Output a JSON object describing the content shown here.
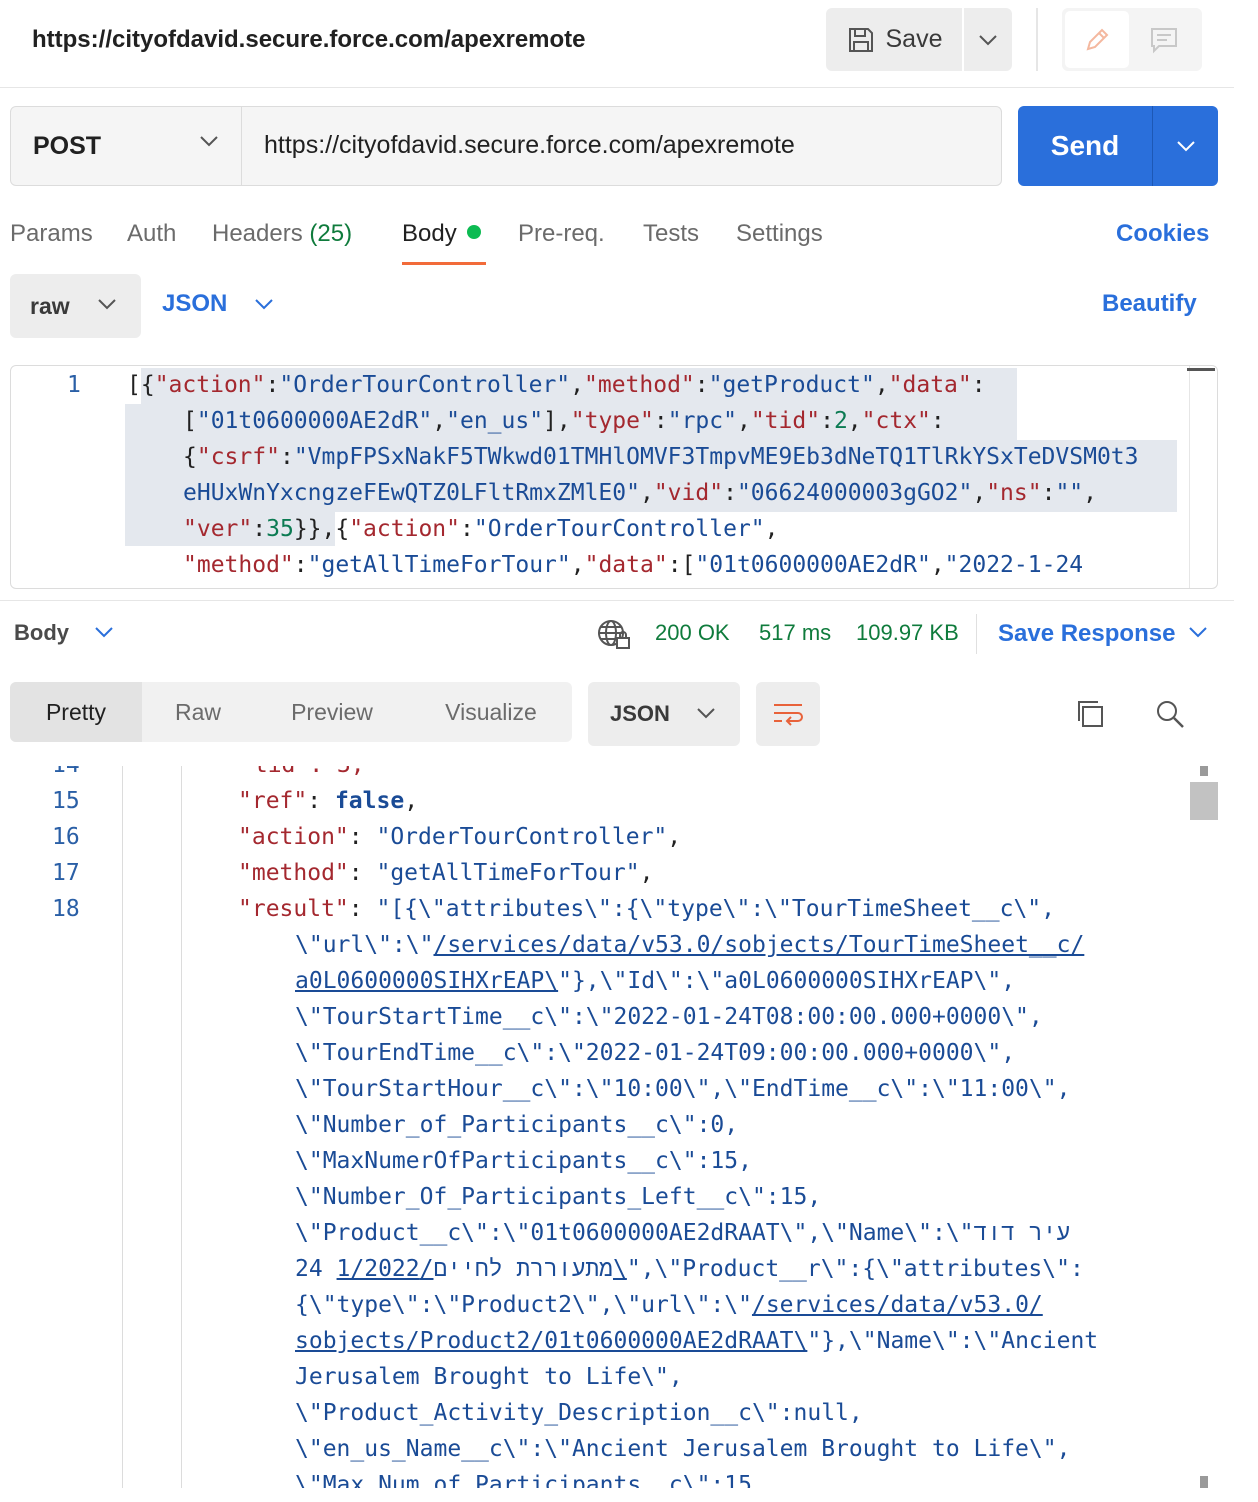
{
  "titlebar": {
    "title": "https://cityofdavid.secure.force.com/apexremote",
    "save_label": "Save"
  },
  "request": {
    "method": "POST",
    "url": "https://cityofdavid.secure.force.com/apexremote",
    "send_label": "Send"
  },
  "tabs": {
    "params": "Params",
    "auth": "Auth",
    "headers": "Headers",
    "headers_count": "(25)",
    "body": "Body",
    "prereq": "Pre-req.",
    "tests": "Tests",
    "settings": "Settings",
    "cookies": "Cookies"
  },
  "body_options": {
    "mode": "raw",
    "language": "JSON",
    "beautify": "Beautify"
  },
  "request_editor": {
    "line_number": "1",
    "lines": [
      "[{\"action\":\"OrderTourController\",\"method\":\"getProduct\",\"data\":",
      "[\"01t0600000AE2dR\",\"en_us\"],\"type\":\"rpc\",\"tid\":2,\"ctx\":",
      "{\"csrf\":\"VmpFPSxNakF5TWkwd01TMHlOMVF3TmpvME9Eb3dNeTQ1TlRkYSxTeDVSM0t3",
      "eHUxWnYxcngzeFEwQTZ0LFltRmxZMlE0\",\"vid\":\"06624000003gGO2\",\"ns\":\"\",",
      "\"ver\":35}},{\"action\":\"OrderTourController\",",
      "\"method\":\"getAllTimeForTour\",\"data\":[\"01t0600000AE2dR\",\"2022-1-24"
    ]
  },
  "response_header": {
    "body_label": "Body",
    "status": "200 OK",
    "time": "517 ms",
    "size": "109.97 KB",
    "save_response": "Save Response"
  },
  "response_view": {
    "tabs": [
      "Pretty",
      "Raw",
      "Preview",
      "Visualize"
    ],
    "active_tab": "Pretty",
    "format": "JSON"
  },
  "response_editor": {
    "partial_line_number": "14",
    "partial_line": "\"tid\": 3,",
    "line_numbers": [
      "15",
      "16",
      "17",
      "18"
    ],
    "line15": {
      "key": "\"ref\"",
      "value": "false"
    },
    "line16": {
      "key": "\"action\"",
      "value": "\"OrderTourController\""
    },
    "line17": {
      "key": "\"method\"",
      "value": "\"getAllTimeForTour\""
    },
    "line18": {
      "key": "\"result\"",
      "value": "\"[{\\\"attributes\\\":{\\\"type\\\":\\\"TourTimeSheet__c\\\","
    },
    "wrap1_pre": "\\\"url\\\":\\\"",
    "wrap1_link": "/services/data/v53.0/sobjects/TourTimeSheet__c/",
    "wrap2_link": "a0L0600000SIHXrEAP\\",
    "wrap2_rest": "\"},\\\"Id\\\":\\\"a0L0600000SIHXrEAP\\\",",
    "wrap3": "\\\"TourStartTime__c\\\":\\\"2022-01-24T08:00:00.000+0000\\\",",
    "wrap4": "\\\"TourEndTime__c\\\":\\\"2022-01-24T09:00:00.000+0000\\\",",
    "wrap5": "\\\"TourStartHour__c\\\":\\\"10:00\\\",\\\"EndTime__c\\\":\\\"11:00\\\",",
    "wrap6": "\\\"Number_of_Participants__c\\\":0,",
    "wrap7": "\\\"MaxNumerOfParticipants__c\\\":15,",
    "wrap8": "\\\"Number_Of_Participants_Left__c\\\":15,",
    "wrap9": "\\\"Product__c\\\":\\\"01t0600000AE2dRAAT\\\",\\\"Name\\\":\\\"עיר דוד",
    "wrap10_pre": "24 מתעוררת לחיים",
    "wrap10_link": "/1/2022\\",
    "wrap10_rest": "\",\\\"Product__r\\\":{\\\"attributes\\\":",
    "wrap11_pre": "{\\\"type\\\":\\\"Product2\\\",\\\"url\\\":\\\"",
    "wrap11_link": "/services/data/v53.0/",
    "wrap12_link": "sobjects/Product2/01t0600000AE2dRAAT\\",
    "wrap12_rest": "\"},\\\"Name\\\":\\\"Ancient",
    "wrap13": "Jerusalem Brought to Life\\\",",
    "wrap14": "\\\"Product_Activity_Description__c\\\":null,",
    "wrap15": "\\\"en_us_Name__c\\\":\\\"Ancient Jerusalem Brought to Life\\\",",
    "wrap16": "\\\"Max_Num_of_Participants__c\\\":15,"
  }
}
